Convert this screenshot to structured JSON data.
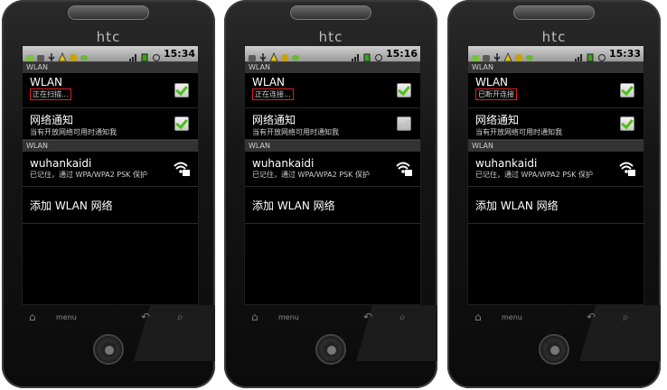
{
  "phones": [
    {
      "brand": "htc",
      "time": "15:34",
      "section_title": "WLAN",
      "wlan_item_title": "WLAN",
      "wlan_status": "正在扫描...",
      "wlan_checked": true,
      "notify_title": "网络通知",
      "notify_sub": "当有开放网络可用时通知我",
      "notify_checked": true,
      "networks_section": "WLAN",
      "ssid": "wuhankaidi",
      "ssid_sub": "已记住，通过 WPA/WPA2 PSK 保护",
      "add_network": "添加 WLAN 网络",
      "menu_label": "menu"
    },
    {
      "brand": "htc",
      "time": "15:16",
      "section_title": "WLAN",
      "wlan_item_title": "WLAN",
      "wlan_status": "正在连接...",
      "wlan_checked": true,
      "notify_title": "网络通知",
      "notify_sub": "当有开放网络可用时通知我",
      "notify_checked": false,
      "networks_section": "WLAN",
      "ssid": "wuhankaidi",
      "ssid_sub": "已记住，通过 WPA/WPA2 PSK 保护",
      "add_network": "添加 WLAN 网络",
      "menu_label": "menu"
    },
    {
      "brand": "htc",
      "time": "15:33",
      "section_title": "WLAN",
      "wlan_item_title": "WLAN",
      "wlan_status": "已断开连接",
      "wlan_checked": true,
      "notify_title": "网络通知",
      "notify_sub": "当有开放网络可用时通知我",
      "notify_checked": true,
      "networks_section": "WLAN",
      "ssid": "wuhankaidi",
      "ssid_sub": "已记住，通过 WPA/WPA2 PSK 保护",
      "add_network": "添加 WLAN 网络",
      "menu_label": "menu"
    }
  ]
}
